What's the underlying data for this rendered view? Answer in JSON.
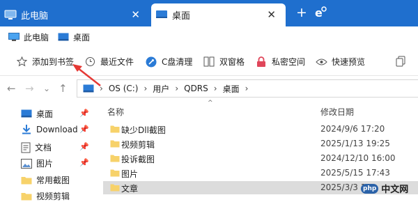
{
  "tabs": [
    {
      "label": "此电脑",
      "icon": "computer-icon",
      "active": false
    },
    {
      "label": "桌面",
      "icon": "desktop-icon",
      "active": true
    }
  ],
  "tabbar": {
    "new_tab": "+",
    "accent": "#1f6fce"
  },
  "bookmarks": [
    {
      "label": "此电脑",
      "icon": "computer-icon"
    },
    {
      "label": "桌面",
      "icon": "desktop-icon"
    }
  ],
  "commands": [
    {
      "label": "添加到书签",
      "icon": "star-icon"
    },
    {
      "label": "最近文件",
      "icon": "clock-icon"
    },
    {
      "label": "C盘清理",
      "icon": "rocket-icon"
    },
    {
      "label": "双窗格",
      "icon": "dual-pane-icon"
    },
    {
      "label": "私密空间",
      "icon": "lock-icon"
    },
    {
      "label": "快速预览",
      "icon": "eye-icon"
    }
  ],
  "address": {
    "crumbs": [
      "OS (C:)",
      "用户",
      "QDRS",
      "桌面"
    ]
  },
  "sidebar": [
    {
      "label": "桌面",
      "icon": "desktop-icon",
      "pinned": true
    },
    {
      "label": "Download",
      "icon": "download-icon",
      "pinned": true
    },
    {
      "label": "文档",
      "icon": "document-icon",
      "pinned": true
    },
    {
      "label": "图片",
      "icon": "picture-icon",
      "pinned": true
    },
    {
      "label": "常用截图",
      "icon": "folder-icon",
      "pinned": false
    },
    {
      "label": "视频剪辑",
      "icon": "folder-icon",
      "pinned": false
    }
  ],
  "columns": {
    "name": "名称",
    "modified": "修改日期"
  },
  "files": [
    {
      "name": "缺少Dll截图",
      "modified": "2024/9/6 17:20"
    },
    {
      "name": "视频剪辑",
      "modified": "2025/1/13 19:25"
    },
    {
      "name": "投诉截图",
      "modified": "2024/12/10 16:00"
    },
    {
      "name": "图片",
      "modified": "2025/5/15 17:43"
    },
    {
      "name": "文章",
      "modified": "2025/3/3 1"
    }
  ],
  "watermark": {
    "logo": "php",
    "text": "中文网"
  }
}
